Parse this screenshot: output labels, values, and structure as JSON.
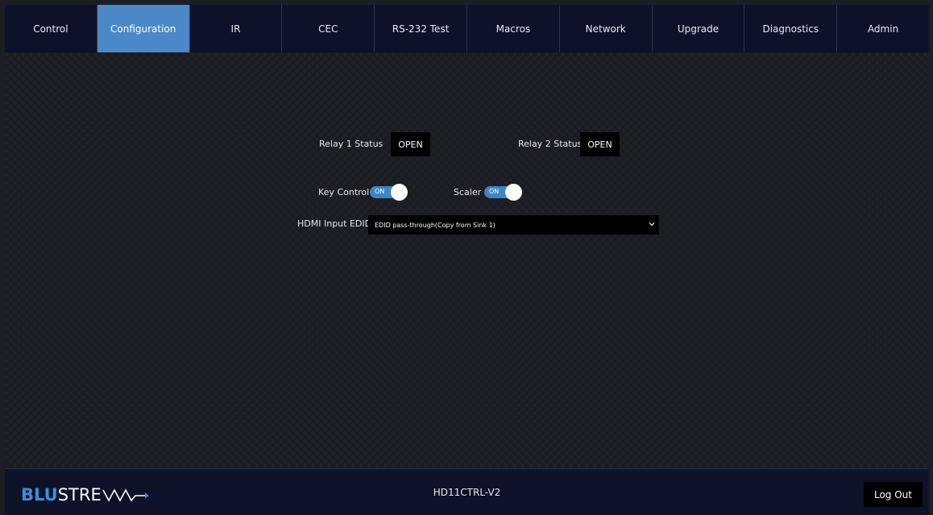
{
  "nav": {
    "tabs": [
      {
        "label": "Control"
      },
      {
        "label": "Configuration"
      },
      {
        "label": "IR"
      },
      {
        "label": "CEC"
      },
      {
        "label": "RS-232 Test"
      },
      {
        "label": "Macros"
      },
      {
        "label": "Network"
      },
      {
        "label": "Upgrade"
      },
      {
        "label": "Diagnostics"
      },
      {
        "label": "Admin"
      }
    ],
    "active_tab": "Configuration"
  },
  "config": {
    "relay1": {
      "label": "Relay 1 Status",
      "value": "OPEN"
    },
    "relay2": {
      "label": "Relay 2 Status",
      "value": "OPEN"
    },
    "key_control": {
      "label": "Key Control",
      "state": "ON"
    },
    "scaler": {
      "label": "Scaler",
      "state": "ON"
    },
    "edid": {
      "label": "HDMI Input EDID",
      "selected": "EDID pass-through(Copy from Sink 1)"
    }
  },
  "footer": {
    "logo_part1": "BLU",
    "logo_part2": "STRE",
    "device_name": "HD11CTRL-V2",
    "logout_label": "Log Out"
  },
  "colors": {
    "accent": "#4a88c7",
    "toggle_on": "#3d86c6",
    "navbar_bg": "#0d1229",
    "page_bg": "#1a1c22"
  }
}
